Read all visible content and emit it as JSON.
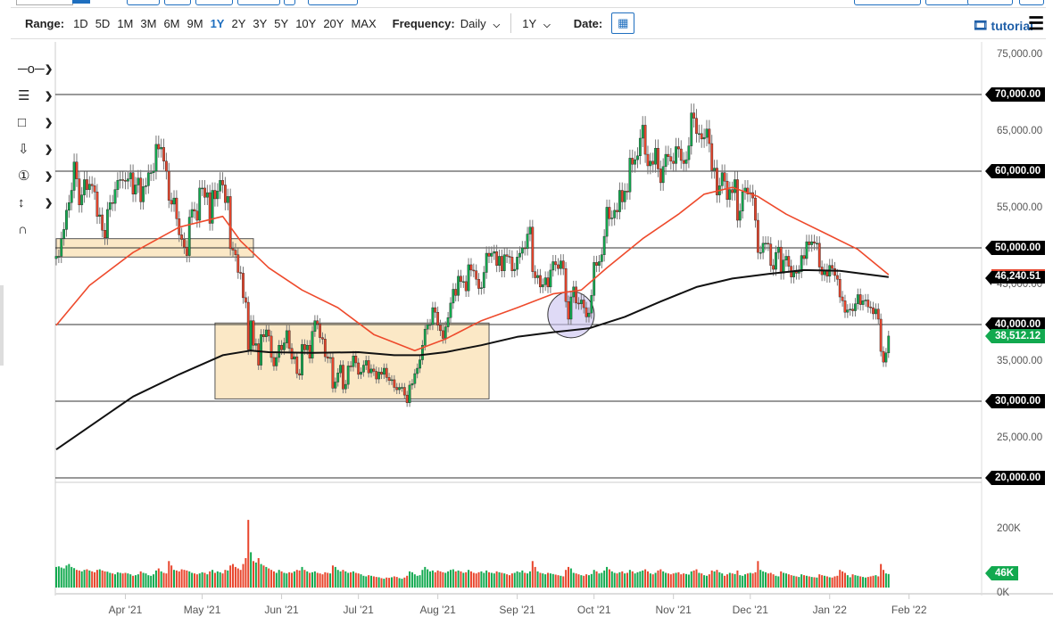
{
  "toolbar": {
    "range_label": "Range:",
    "ranges": [
      "1D",
      "5D",
      "1M",
      "3M",
      "6M",
      "9M",
      "1Y",
      "2Y",
      "3Y",
      "5Y",
      "10Y",
      "20Y",
      "MAX"
    ],
    "active_range": "1Y",
    "frequency_label": "Frequency:",
    "frequency_value": "Daily",
    "period_value": "1Y",
    "date_label": "Date:",
    "tutorial_label": "tutorial"
  },
  "tools": [
    "line-tool-icon",
    "fibonacci-tool-icon",
    "rectangle-tool-icon",
    "arrow-down-tool-icon",
    "numbered-note-icon",
    "measure-tool-icon",
    "magnet-icon"
  ],
  "colors": {
    "up": "#12a94f",
    "down": "#e8452c",
    "ma50": "#ee4a2c",
    "ma200": "#111111",
    "box_fill": "#fbe8c6",
    "circle_fill": "#c9c2f0"
  },
  "chart_data": {
    "type": "candlestick",
    "start_date": "2021-03-05",
    "units": "USD (thousands)",
    "ylim": [
      20000,
      75000
    ],
    "y_ticks": [
      "75,000.00",
      "70,000.00",
      "65,000.00",
      "60,000.00",
      "55,000.00",
      "50,000.00",
      "45,000.00",
      "40,000.00",
      "35,000.00",
      "30,000.00",
      "25,000.00",
      "20,000.00"
    ],
    "y_tick_values": [
      75,
      70,
      65,
      60,
      55,
      50,
      45,
      40,
      35,
      30,
      25,
      20
    ],
    "highlighted_levels": [
      "70,000.00",
      "60,000.00",
      "50,000.00",
      "40,000.00",
      "30,000.00",
      "20,000.00"
    ],
    "x_ticks": [
      {
        "label": "Apr '21",
        "day": 27
      },
      {
        "label": "May '21",
        "day": 57
      },
      {
        "label": "Jun '21",
        "day": 88
      },
      {
        "label": "Jul '21",
        "day": 118
      },
      {
        "label": "Aug '21",
        "day": 149
      },
      {
        "label": "Sep '21",
        "day": 180
      },
      {
        "label": "Oct '21",
        "day": 210
      },
      {
        "label": "Nov '21",
        "day": 241
      },
      {
        "label": "Dec '21",
        "day": 271
      },
      {
        "label": "Jan '22",
        "day": 302
      },
      {
        "label": "Feb '22",
        "day": 333
      }
    ],
    "closes": [
      48.9,
      48.9,
      51.2,
      52.4,
      54.9,
      55.9,
      57.5,
      61.2,
      59.0,
      55.6,
      56.9,
      58.9,
      57.6,
      58.3,
      58.1,
      57.3,
      54.1,
      54.3,
      52.3,
      51.3,
      55.0,
      55.9,
      55.8,
      57.6,
      58.8,
      58.9,
      58.8,
      58.7,
      59.0,
      59.8,
      57.0,
      58.2,
      59.1,
      56.0,
      58.0,
      58.1,
      59.8,
      59.8,
      60.0,
      63.5,
      62.9,
      63.1,
      61.3,
      60.0,
      56.2,
      55.7,
      56.5,
      53.8,
      51.7,
      51.1,
      50.1,
      49.0,
      54.0,
      55.0,
      54.8,
      53.6,
      57.8,
      57.8,
      56.6,
      57.2,
      53.2,
      57.5,
      56.4,
      57.4,
      58.8,
      58.2,
      55.9,
      56.7,
      49.9,
      49.7,
      49.1,
      46.8,
      46.7,
      43.5,
      42.9,
      36.7,
      40.5,
      37.3,
      37.5,
      34.7,
      38.7,
      38.4,
      39.3,
      38.5,
      35.7,
      34.6,
      35.7,
      37.3,
      36.7,
      37.6,
      39.2,
      36.9,
      35.5,
      35.8,
      33.6,
      33.4,
      37.4,
      36.7,
      37.3,
      35.6,
      39.1,
      40.5,
      40.1,
      38.3,
      38.1,
      35.8,
      35.6,
      35.7,
      31.7,
      32.5,
      33.7,
      34.7,
      31.6,
      32.2,
      34.6,
      34.5,
      35.9,
      35.0,
      33.5,
      33.8,
      34.7,
      35.3,
      33.7,
      34.2,
      33.9,
      32.9,
      33.8,
      33.5,
      34.3,
      33.1,
      32.7,
      32.8,
      31.8,
      31.5,
      31.8,
      31.8,
      30.8,
      29.8,
      32.1,
      32.3,
      33.6,
      34.3,
      35.4,
      37.3,
      39.4,
      40.0,
      40.0,
      42.2,
      41.6,
      39.9,
      39.2,
      38.2,
      39.7,
      40.9,
      42.8,
      44.6,
      43.8,
      46.3,
      45.6,
      45.6,
      44.4,
      47.8,
      47.1,
      47.0,
      45.9,
      44.7,
      44.8,
      46.8,
      49.3,
      48.9,
      49.3,
      49.5,
      47.7,
      48.9,
      47.0,
      49.1,
      48.9,
      48.8,
      47.0,
      47.2,
      48.8,
      49.3,
      50.0,
      49.9,
      51.8,
      52.7,
      46.9,
      46.1,
      46.4,
      44.9,
      45.2,
      46.1,
      44.9,
      47.1,
      48.2,
      47.8,
      47.3,
      48.3,
      47.3,
      43.0,
      40.7,
      43.6,
      44.9,
      42.8,
      42.7,
      43.2,
      42.2,
      41.0,
      41.5,
      43.8,
      48.1,
      47.7,
      48.2,
      49.1,
      51.5,
      55.3,
      53.8,
      53.9,
      54.9,
      54.7,
      57.5,
      56.0,
      57.4,
      57.3,
      61.7,
      60.9,
      61.5,
      62.0,
      64.3,
      66.0,
      62.2,
      60.7,
      61.3,
      60.9,
      63.0,
      60.3,
      58.5,
      60.6,
      62.2,
      61.9,
      61.3,
      61.0,
      63.2,
      62.9,
      61.4,
      61.0,
      61.5,
      63.3,
      67.6,
      66.9,
      64.9,
      64.9,
      64.2,
      64.4,
      65.5,
      63.6,
      60.1,
      60.4,
      56.9,
      58.1,
      59.8,
      58.7,
      56.3,
      57.6,
      57.2,
      58.9,
      53.6,
      54.8,
      57.3,
      57.8,
      57.0,
      57.2,
      56.5,
      53.6,
      49.4,
      49.4,
      50.6,
      50.6,
      50.5,
      47.7,
      47.2,
      49.4,
      50.1,
      46.7,
      48.4,
      48.9,
      47.6,
      46.2,
      46.9,
      46.7,
      46.9,
      49.0,
      48.6,
      50.8,
      50.4,
      50.8,
      50.6,
      50.6,
      47.5,
      46.5,
      47.1,
      46.3,
      47.7,
      47.3,
      46.4,
      45.9,
      43.6,
      43.1,
      41.6,
      41.9,
      42.0,
      41.8,
      42.7,
      43.9,
      42.6,
      43.1,
      43.2,
      42.3,
      42.2,
      41.4,
      42.0,
      40.7,
      36.5,
      35.1,
      36.3,
      38.5
    ],
    "volumes_k": [
      70,
      72,
      68,
      65,
      75,
      80,
      70,
      66,
      60,
      58,
      55,
      60,
      62,
      58,
      55,
      52,
      60,
      62,
      58,
      55,
      54,
      50,
      48,
      45,
      52,
      50,
      48,
      50,
      48,
      45,
      40,
      42,
      45,
      55,
      50,
      48,
      42,
      40,
      45,
      58,
      65,
      55,
      50,
      48,
      90,
      75,
      60,
      58,
      55,
      62,
      60,
      58,
      55,
      50,
      48,
      45,
      48,
      52,
      50,
      45,
      55,
      60,
      50,
      55,
      52,
      48,
      60,
      58,
      75,
      80,
      70,
      65,
      60,
      80,
      100,
      230,
      120,
      90,
      85,
      100,
      80,
      75,
      70,
      65,
      60,
      55,
      50,
      60,
      55,
      50,
      48,
      52,
      50,
      55,
      60,
      58,
      70,
      60,
      55,
      50,
      52,
      55,
      50,
      48,
      45,
      52,
      50,
      48,
      75,
      70,
      60,
      55,
      60,
      55,
      50,
      52,
      55,
      50,
      48,
      45,
      40,
      38,
      42,
      40,
      38,
      36,
      35,
      32,
      30,
      34,
      33,
      35,
      38,
      36,
      32,
      30,
      34,
      40,
      55,
      52,
      45,
      40,
      42,
      60,
      70,
      62,
      55,
      58,
      52,
      58,
      55,
      52,
      50,
      55,
      60,
      62,
      55,
      58,
      55,
      50,
      52,
      60,
      55,
      50,
      48,
      52,
      55,
      50,
      58,
      52,
      50,
      48,
      55,
      52,
      50,
      48,
      45,
      42,
      48,
      50,
      55,
      52,
      58,
      50,
      48,
      55,
      90,
      70,
      55,
      50,
      48,
      45,
      50,
      48,
      46,
      44,
      42,
      40,
      38,
      60,
      70,
      65,
      50,
      48,
      45,
      42,
      40,
      45,
      42,
      46,
      60,
      55,
      48,
      50,
      58,
      70,
      62,
      55,
      50,
      48,
      52,
      55,
      48,
      50,
      60,
      55,
      48,
      52,
      55,
      58,
      62,
      55,
      48,
      45,
      50,
      58,
      62,
      55,
      50,
      48,
      45,
      48,
      50,
      52,
      45,
      48,
      46,
      44,
      55,
      58,
      62,
      50,
      48,
      42,
      40,
      45,
      58,
      55,
      60,
      52,
      48,
      40,
      45,
      50,
      48,
      46,
      58,
      42,
      40,
      45,
      48,
      50,
      48,
      52,
      90,
      60,
      55,
      52,
      48,
      50,
      45,
      40,
      38,
      55,
      50,
      48,
      45,
      42,
      40,
      38,
      36,
      45,
      42,
      40,
      38,
      36,
      35,
      34,
      45,
      42,
      40,
      38,
      35,
      34,
      38,
      40,
      60,
      55,
      50,
      42,
      35,
      45,
      42,
      40,
      38,
      36,
      34,
      36,
      38,
      40,
      42,
      38,
      80,
      60,
      48,
      46
    ],
    "volume_ticks": [
      "200K",
      "0K"
    ],
    "volume_tick_values": [
      200,
      0
    ],
    "last_volume_label": "46K",
    "last_price_label": "38,512.12",
    "ma200_label": "46,240.51",
    "ma50": [
      [
        0,
        39.9
      ],
      [
        13,
        45.1
      ],
      [
        30,
        49.4
      ],
      [
        48,
        52.7
      ],
      [
        65,
        54.1
      ],
      [
        72,
        50.9
      ],
      [
        83,
        47.4
      ],
      [
        96,
        44.5
      ],
      [
        110,
        42.2
      ],
      [
        124,
        38.7
      ],
      [
        140,
        36.6
      ],
      [
        152,
        38.1
      ],
      [
        166,
        40.5
      ],
      [
        180,
        42.2
      ],
      [
        194,
        44
      ],
      [
        205,
        44.5
      ],
      [
        215,
        47.4
      ],
      [
        229,
        51.2
      ],
      [
        243,
        54.4
      ],
      [
        253,
        57
      ],
      [
        264,
        57.9
      ],
      [
        274,
        56.7
      ],
      [
        285,
        54.4
      ],
      [
        299,
        52.1
      ],
      [
        313,
        49.8
      ],
      [
        325,
        46.5
      ]
    ],
    "ma200": [
      [
        0,
        23.7
      ],
      [
        13,
        26.7
      ],
      [
        30,
        30.6
      ],
      [
        48,
        33.5
      ],
      [
        65,
        36.0
      ],
      [
        76,
        36.6
      ],
      [
        83,
        36.4
      ],
      [
        100,
        36.3
      ],
      [
        118,
        36.4
      ],
      [
        132,
        36.0
      ],
      [
        142,
        36.0
      ],
      [
        152,
        36.4
      ],
      [
        166,
        37.3
      ],
      [
        180,
        38.4
      ],
      [
        194,
        39.0
      ],
      [
        208,
        39.5
      ],
      [
        222,
        41.0
      ],
      [
        236,
        43.0
      ],
      [
        250,
        44.9
      ],
      [
        264,
        46.0
      ],
      [
        278,
        46.6
      ],
      [
        292,
        47.1
      ],
      [
        306,
        47.0
      ],
      [
        325,
        46.2
      ]
    ],
    "boxes": [
      {
        "from_day": 0,
        "to_day": 77,
        "low": 48.8,
        "high": 51.2
      },
      {
        "from_day": 62,
        "to_day": 169,
        "low": 30.3,
        "high": 40.2
      }
    ],
    "circle": {
      "day": 201,
      "price": 41.3
    }
  }
}
